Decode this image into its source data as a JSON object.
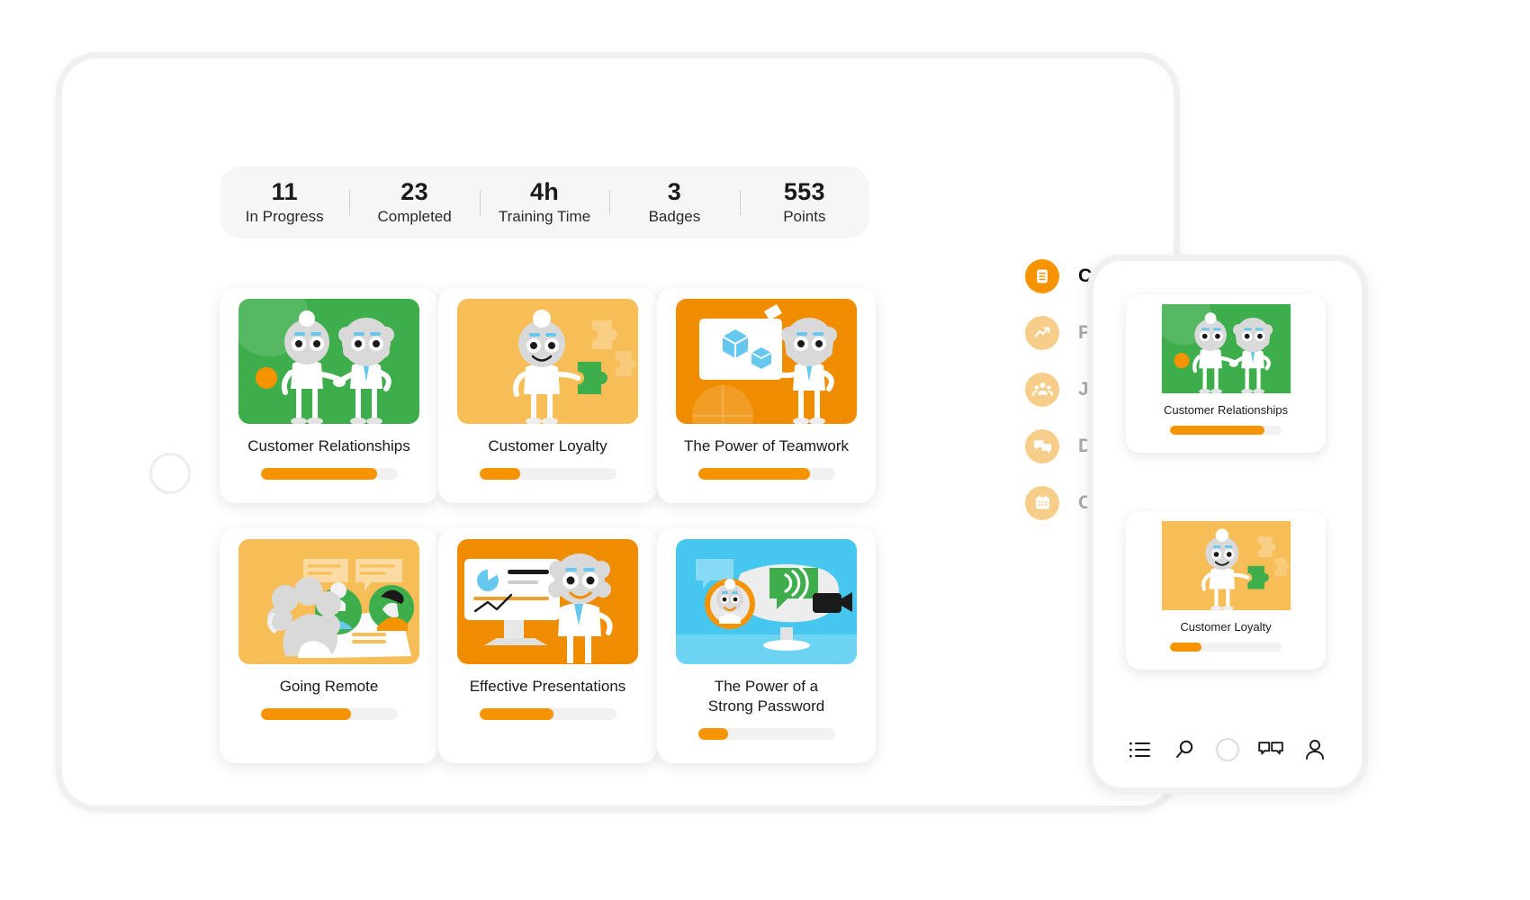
{
  "stats": [
    {
      "value": "11",
      "label": "In Progress"
    },
    {
      "value": "23",
      "label": "Completed"
    },
    {
      "value": "4h",
      "label": "Training Time"
    },
    {
      "value": "3",
      "label": "Badges"
    },
    {
      "value": "553",
      "label": "Points"
    }
  ],
  "nav": {
    "items": [
      {
        "label": "COURSE CATALOG",
        "icon": "catalog-list-icon",
        "active": true
      },
      {
        "label": "PROGRESS",
        "icon": "trending-up-icon",
        "active": false
      },
      {
        "label": "JOIN GROUP",
        "icon": "people-group-icon",
        "active": false
      },
      {
        "label": "DISCUSSIONS",
        "icon": "chat-bubbles-icon",
        "active": false
      },
      {
        "label": "CALENDAR",
        "icon": "calendar-icon",
        "active": false
      }
    ]
  },
  "courses": [
    {
      "title": "Customer Relationships",
      "progress": 85,
      "theme": "green",
      "art": "handshake"
    },
    {
      "title": "Customer Loyalty",
      "progress": 30,
      "theme": "light-orange",
      "art": "puzzle"
    },
    {
      "title": "The Power of Teamwork",
      "progress": 82,
      "theme": "orange",
      "art": "whiteboard"
    },
    {
      "title": "Going Remote",
      "progress": 66,
      "theme": "light-orange",
      "art": "videocall"
    },
    {
      "title": "Effective Presentations",
      "progress": 54,
      "theme": "orange",
      "art": "presentation"
    },
    {
      "title": "The Power of a\nStrong Password",
      "progress": 22,
      "theme": "blue",
      "art": "password"
    }
  ],
  "phone": {
    "cards": [
      {
        "title": "Customer Relationships",
        "progress": 85,
        "theme": "green",
        "art": "handshake"
      },
      {
        "title": "Customer Loyalty",
        "progress": 28,
        "theme": "light-orange",
        "art": "puzzle"
      }
    ],
    "nav": [
      {
        "icon": "list-icon"
      },
      {
        "icon": "search-icon"
      },
      {
        "icon": "home-circle-icon"
      },
      {
        "icon": "chat-bubbles-icon"
      },
      {
        "icon": "user-profile-icon"
      }
    ]
  },
  "colors": {
    "accent": "#f59300",
    "accent_soft": "#f7cd8a",
    "green": "#3dae4b",
    "light_orange": "#f7bd56",
    "orange": "#f08c00",
    "blue": "#45c7f0",
    "track": "#f1f1f1",
    "text": "#1a1a1a",
    "muted": "#a8a8a8"
  }
}
